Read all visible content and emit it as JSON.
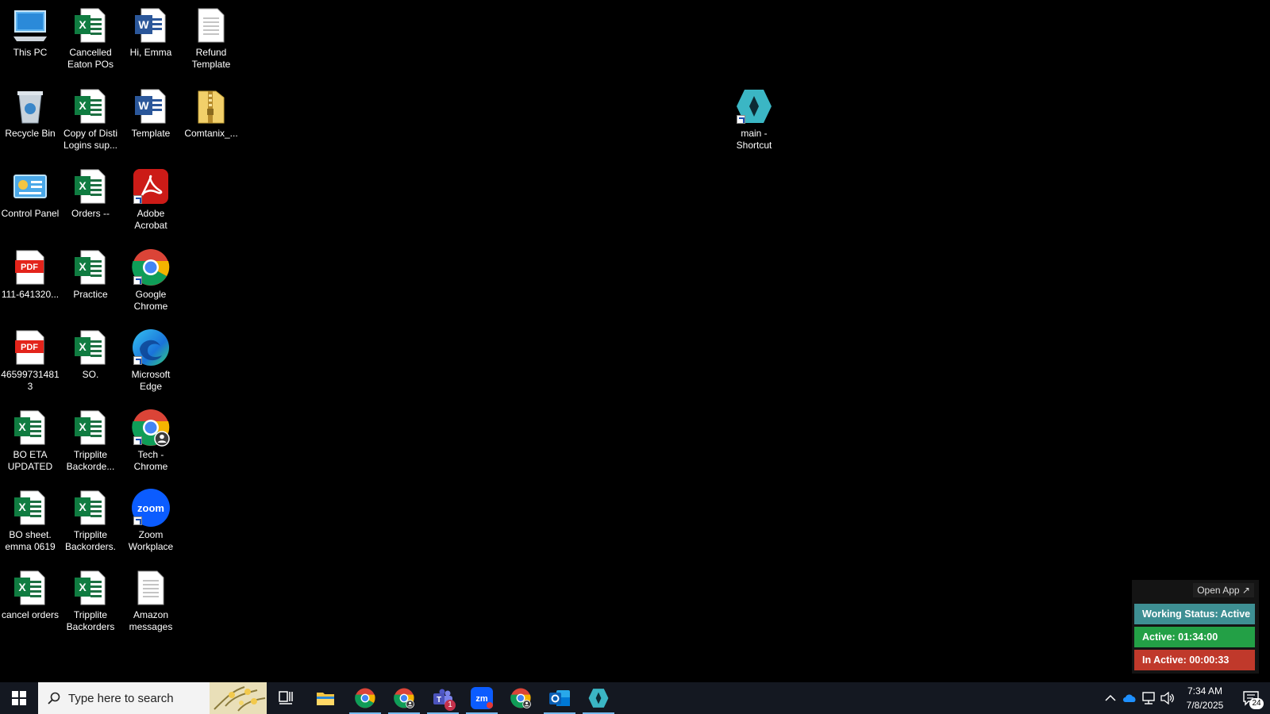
{
  "desktop": {
    "icons": [
      {
        "label": "This PC",
        "type": "pc"
      },
      {
        "label": "Recycle Bin",
        "type": "recycle"
      },
      {
        "label": "Control Panel",
        "type": "control"
      },
      {
        "label": "111-641320...",
        "type": "pdf"
      },
      {
        "label": "465997314813",
        "type": "pdf"
      },
      {
        "label": "BO ETA UPDATED",
        "type": "excel"
      },
      {
        "label": "BO sheet. emma 0619",
        "type": "excel"
      },
      {
        "label": "cancel orders",
        "type": "excel"
      },
      {
        "label": "Cancelled Eaton POs",
        "type": "excel"
      },
      {
        "label": "Copy of Disti Logins sup...",
        "type": "excel"
      },
      {
        "label": "Orders --",
        "type": "excel"
      },
      {
        "label": "Practice",
        "type": "excel"
      },
      {
        "label": "SO.",
        "type": "excel"
      },
      {
        "label": "Tripplite Backorde...",
        "type": "excel"
      },
      {
        "label": "Tripplite Backorders.",
        "type": "excel"
      },
      {
        "label": "Tripplite Backorders",
        "type": "excel"
      },
      {
        "label": "Hi, Emma",
        "type": "word"
      },
      {
        "label": "Template",
        "type": "word"
      },
      {
        "label": "Adobe Acrobat",
        "type": "acrobat"
      },
      {
        "label": "Google Chrome",
        "type": "chrome"
      },
      {
        "label": "Microsoft Edge",
        "type": "edge"
      },
      {
        "label": "Tech - Chrome",
        "type": "chrome-profile"
      },
      {
        "label": "Zoom Workplace",
        "type": "zoom"
      },
      {
        "label": "Amazon messages",
        "type": "text"
      },
      {
        "label": "Refund Template",
        "type": "text"
      },
      {
        "label": "Comtanix_...",
        "type": "zip"
      },
      {
        "label": "main - Shortcut",
        "type": "app"
      }
    ]
  },
  "widget": {
    "open_app": "Open App ↗",
    "status": "Working Status: Active",
    "active": "Active: 01:34:00",
    "inactive": "In Active: 00:00:33",
    "colors": {
      "status": "#3e8f93",
      "active": "#23a046",
      "inactive": "#c0392b"
    }
  },
  "taskbar": {
    "search_placeholder": "Type here to search",
    "teams_badge": "1",
    "time": "7:34 AM",
    "date": "7/8/2025",
    "notifications": "24"
  }
}
